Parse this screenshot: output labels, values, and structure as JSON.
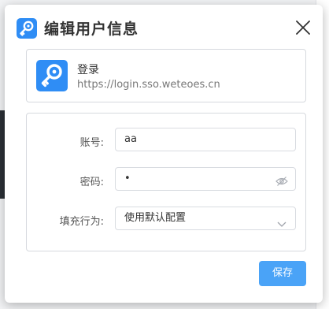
{
  "dialog": {
    "title": "编辑用户信息",
    "close_icon": "close-icon",
    "app_icon": "key-icon"
  },
  "site": {
    "name": "登录",
    "url": "https://login.sso.weteoes.cn",
    "icon": "key-icon"
  },
  "form": {
    "account_label": "账号:",
    "account_value": "aa",
    "password_label": "密码:",
    "password_value": "•",
    "password_toggle_icon": "eye-hidden-icon",
    "fill_label": "填充行为:",
    "fill_value": "使用默认配置",
    "fill_dropdown_icon": "chevron-down-icon"
  },
  "actions": {
    "save_label": "保存"
  },
  "colors": {
    "accent": "#2f8df5",
    "button": "#4aa3f7"
  }
}
